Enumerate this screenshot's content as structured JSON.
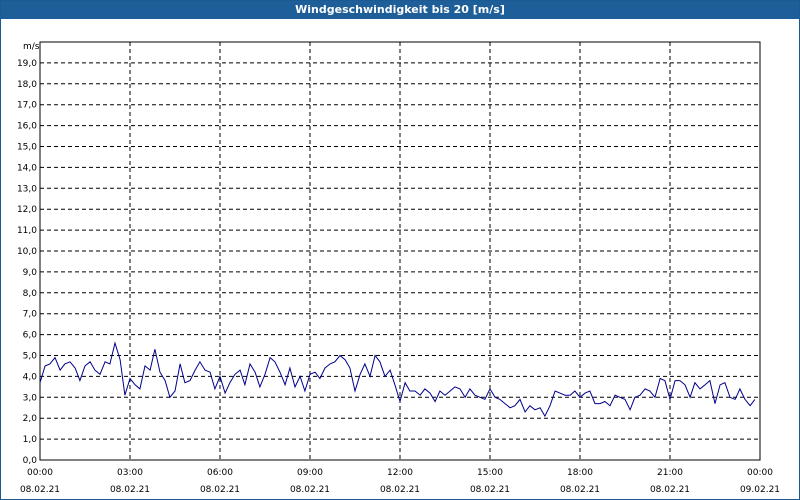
{
  "window": {
    "title": "Windgeschwindigkeit bis 20 [m/s]"
  },
  "chart_data": {
    "type": "line",
    "title": "Windgeschwindigkeit bis 20 [m/s]",
    "ylabel": "m/s",
    "xlabel": "",
    "ylim": [
      0,
      20
    ],
    "xlim": [
      0,
      24
    ],
    "grid": true,
    "y_ticks": [
      "0,0",
      "1,0",
      "2,0",
      "3,0",
      "4,0",
      "5,0",
      "6,0",
      "7,0",
      "8,0",
      "9,0",
      "10,0",
      "11,0",
      "12,0",
      "13,0",
      "14,0",
      "15,0",
      "16,0",
      "17,0",
      "18,0",
      "19,0"
    ],
    "x_ticks": [
      {
        "time": "00:00",
        "date": "08.02.21"
      },
      {
        "time": "03:00",
        "date": "08.02.21"
      },
      {
        "time": "06:00",
        "date": "08.02.21"
      },
      {
        "time": "09:00",
        "date": "08.02.21"
      },
      {
        "time": "12:00",
        "date": "08.02.21"
      },
      {
        "time": "15:00",
        "date": "08.02.21"
      },
      {
        "time": "18:00",
        "date": "08.02.21"
      },
      {
        "time": "21:00",
        "date": "08.02.21"
      },
      {
        "time": "00:00",
        "date": "09.02.21"
      }
    ],
    "series": [
      {
        "color": "#00008b",
        "x": [
          0,
          0.17,
          0.33,
          0.5,
          0.67,
          0.83,
          1,
          1.17,
          1.33,
          1.5,
          1.67,
          1.83,
          2,
          2.17,
          2.33,
          2.5,
          2.67,
          2.83,
          3,
          3.17,
          3.33,
          3.5,
          3.67,
          3.83,
          4,
          4.17,
          4.33,
          4.5,
          4.67,
          4.83,
          5,
          5.17,
          5.33,
          5.5,
          5.67,
          5.83,
          6,
          6.17,
          6.33,
          6.5,
          6.67,
          6.83,
          7,
          7.17,
          7.33,
          7.5,
          7.67,
          7.83,
          8,
          8.17,
          8.33,
          8.5,
          8.67,
          8.83,
          9,
          9.17,
          9.33,
          9.5,
          9.67,
          9.83,
          10,
          10.17,
          10.33,
          10.5,
          10.67,
          10.83,
          11,
          11.17,
          11.33,
          11.5,
          11.67,
          11.83,
          12,
          12.17,
          12.33,
          12.5,
          12.67,
          12.83,
          13,
          13.17,
          13.33,
          13.5,
          13.67,
          13.83,
          14,
          14.17,
          14.33,
          14.5,
          14.67,
          14.83,
          15,
          15.17,
          15.33,
          15.5,
          15.67,
          15.83,
          16,
          16.17,
          16.33,
          16.5,
          16.67,
          16.83,
          17,
          17.17,
          17.33,
          17.5,
          17.67,
          17.83,
          18,
          18.17,
          18.33,
          18.5,
          18.67,
          18.83,
          19,
          19.17,
          19.33,
          19.5,
          19.67,
          19.83,
          20,
          20.17,
          20.33,
          20.5,
          20.67,
          20.83,
          21,
          21.17,
          21.33,
          21.5,
          21.67,
          21.83,
          22,
          22.17,
          22.33,
          22.5,
          22.67,
          22.83,
          23,
          23.17,
          23.33,
          23.5,
          23.67,
          23.83
        ],
        "values": [
          3.7,
          4.5,
          4.6,
          4.9,
          4.3,
          4.6,
          4.7,
          4.4,
          3.8,
          4.5,
          4.7,
          4.3,
          4.1,
          4.7,
          4.6,
          5.6,
          4.8,
          3.1,
          3.9,
          3.6,
          3.4,
          4.5,
          4.3,
          5.3,
          4.2,
          3.8,
          3.0,
          3.3,
          4.6,
          3.7,
          3.8,
          4.3,
          4.7,
          4.3,
          4.2,
          3.4,
          4.0,
          3.2,
          3.7,
          4.1,
          4.3,
          3.6,
          4.6,
          4.2,
          3.5,
          4.1,
          4.9,
          4.7,
          4.2,
          3.6,
          4.4,
          3.5,
          4.0,
          3.3,
          4.1,
          4.2,
          3.9,
          4.4,
          4.6,
          4.7,
          5.0,
          4.8,
          4.4,
          3.3,
          4.1,
          4.6,
          4.0,
          5.0,
          4.7,
          4.0,
          4.3,
          3.6,
          2.8,
          3.7,
          3.3,
          3.3,
          3.1,
          3.4,
          3.2,
          2.8,
          3.3,
          3.1,
          3.3,
          3.5,
          3.4,
          3.0,
          3.4,
          3.1,
          3.0,
          2.9,
          3.4,
          3.0,
          2.9,
          2.7,
          2.5,
          2.6,
          2.9,
          2.3,
          2.6,
          2.4,
          2.5,
          2.1,
          2.6,
          3.3,
          3.2,
          3.1,
          3.1,
          3.3,
          3.0,
          3.2,
          3.3,
          2.7,
          2.7,
          2.8,
          2.6,
          3.1,
          3.0,
          2.9,
          2.4,
          3.0,
          3.1,
          3.4,
          3.3,
          3.0,
          3.9,
          3.8,
          2.9,
          3.8,
          3.8,
          3.6,
          3.0,
          3.7,
          3.4,
          3.6,
          3.8,
          2.7,
          3.6,
          3.7,
          3.0,
          2.9,
          3.4,
          2.9,
          2.6,
          2.9
        ]
      }
    ]
  }
}
